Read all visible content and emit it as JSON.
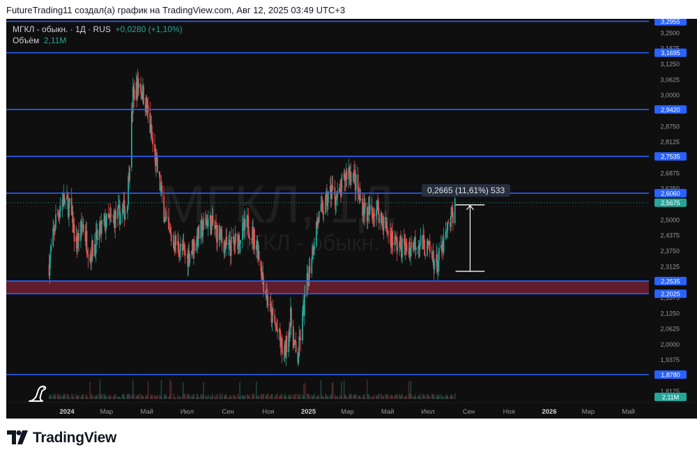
{
  "caption": "FutureTrading11 создал(а) график на TradingView.com, Авг 12, 2025 03:49 UTC+3",
  "header": {
    "symbol_line": "МГКЛ - обыкн. · 1Д · RUS",
    "change": "+0,0280 (+1,10%)",
    "volume_label": "Объём",
    "volume_value": "2,11M"
  },
  "measure_label": "0,2665 (11,61%) 533",
  "watermark": {
    "line1": "МГКЛ, 1Д",
    "line2": "МГКЛ - обыкн."
  },
  "brand": "TradingView",
  "colors": {
    "background": "#0f0f0f",
    "up": "#26a69a",
    "down": "#ef5350",
    "level_line": "#2962ff",
    "zone": "#6d1f33",
    "last_price": "#26a69a"
  },
  "chart_data": {
    "type": "candlestick",
    "symbol": "МГКЛ",
    "interval": "1Д",
    "y_axis_ticks": [
      "3,2500",
      "3,1875",
      "3,1250",
      "3,0625",
      "3,0000",
      "2,9375",
      "2,8750",
      "2,8125",
      "2,7500",
      "2,6875",
      "2,6250",
      "2,5625",
      "2,5000",
      "2,4375",
      "2,3750",
      "2,3125",
      "2,2500",
      "2,1875",
      "2,1250",
      "2,0625",
      "2,0000",
      "1,9375",
      "1,8750",
      "1,8125"
    ],
    "x_axis_ticks": [
      {
        "label": "2024",
        "bold": true,
        "date": "2024-01-01"
      },
      {
        "label": "Мар",
        "bold": false,
        "date": "2024-03-01"
      },
      {
        "label": "Май",
        "bold": false,
        "date": "2024-05-01"
      },
      {
        "label": "Июл",
        "bold": false,
        "date": "2024-07-01"
      },
      {
        "label": "Сен",
        "bold": false,
        "date": "2024-09-01"
      },
      {
        "label": "Ноя",
        "bold": false,
        "date": "2024-11-01"
      },
      {
        "label": "2025",
        "bold": true,
        "date": "2025-01-01"
      },
      {
        "label": "Мар",
        "bold": false,
        "date": "2025-03-01"
      },
      {
        "label": "Май",
        "bold": false,
        "date": "2025-05-01"
      },
      {
        "label": "Июл",
        "bold": false,
        "date": "2025-07-01"
      },
      {
        "label": "Сен",
        "bold": false,
        "date": "2025-09-01"
      },
      {
        "label": "Ноя",
        "bold": false,
        "date": "2025-11-01"
      },
      {
        "label": "2026",
        "bold": true,
        "date": "2026-01-01"
      },
      {
        "label": "Мар",
        "bold": false,
        "date": "2026-03-01"
      },
      {
        "label": "Май",
        "bold": false,
        "date": "2026-05-01"
      }
    ],
    "x_range": [
      "2023-10-01",
      "2026-06-01"
    ],
    "ylim": [
      1.78,
      3.3
    ],
    "horizontal_levels": [
      {
        "value": 3.2955,
        "label": "3,2955"
      },
      {
        "value": 3.1695,
        "label": "3,1695"
      },
      {
        "value": 2.942,
        "label": "2,9420"
      },
      {
        "value": 2.7535,
        "label": "2,7535"
      },
      {
        "value": 2.606,
        "label": "2,6060"
      },
      {
        "value": 2.2535,
        "label": "2,2535"
      },
      {
        "value": 2.2025,
        "label": "2,2025"
      },
      {
        "value": 1.878,
        "label": "1,8780"
      }
    ],
    "zone": {
      "from": 2.2025,
      "to": 2.2535
    },
    "last_price": {
      "value": 2.5675,
      "label": "2,5675"
    },
    "volume_last": "2,11M",
    "measure": {
      "from_date": "2025-08-12",
      "to_date": "2025-09-25",
      "low": 2.2925,
      "high": 2.559
    },
    "price_path": [
      {
        "date": "2023-12-05",
        "value": 2.32
      },
      {
        "date": "2023-12-15",
        "value": 2.5
      },
      {
        "date": "2023-12-25",
        "value": 2.58
      },
      {
        "date": "2024-01-05",
        "value": 2.55
      },
      {
        "date": "2024-01-15",
        "value": 2.4
      },
      {
        "date": "2024-01-25",
        "value": 2.48
      },
      {
        "date": "2024-02-05",
        "value": 2.36
      },
      {
        "date": "2024-02-15",
        "value": 2.42
      },
      {
        "date": "2024-02-25",
        "value": 2.48
      },
      {
        "date": "2024-03-10",
        "value": 2.5
      },
      {
        "date": "2024-03-20",
        "value": 2.52
      },
      {
        "date": "2024-04-01",
        "value": 2.55
      },
      {
        "date": "2024-04-10",
        "value": 3.0
      },
      {
        "date": "2024-04-20",
        "value": 3.05
      },
      {
        "date": "2024-05-01",
        "value": 2.95
      },
      {
        "date": "2024-05-10",
        "value": 2.8
      },
      {
        "date": "2024-05-20",
        "value": 2.65
      },
      {
        "date": "2024-06-01",
        "value": 2.45
      },
      {
        "date": "2024-06-15",
        "value": 2.4
      },
      {
        "date": "2024-07-01",
        "value": 2.35
      },
      {
        "date": "2024-07-15",
        "value": 2.42
      },
      {
        "date": "2024-08-01",
        "value": 2.5
      },
      {
        "date": "2024-08-15",
        "value": 2.45
      },
      {
        "date": "2024-09-01",
        "value": 2.38
      },
      {
        "date": "2024-09-15",
        "value": 2.42
      },
      {
        "date": "2024-10-01",
        "value": 2.48
      },
      {
        "date": "2024-10-15",
        "value": 2.4
      },
      {
        "date": "2024-10-25",
        "value": 2.25
      },
      {
        "date": "2024-11-05",
        "value": 2.12
      },
      {
        "date": "2024-11-15",
        "value": 2.05
      },
      {
        "date": "2024-11-25",
        "value": 1.95
      },
      {
        "date": "2024-12-05",
        "value": 2.1
      },
      {
        "date": "2024-12-15",
        "value": 1.92
      },
      {
        "date": "2024-12-25",
        "value": 2.15
      },
      {
        "date": "2025-01-05",
        "value": 2.35
      },
      {
        "date": "2025-01-15",
        "value": 2.5
      },
      {
        "date": "2025-01-25",
        "value": 2.55
      },
      {
        "date": "2025-02-05",
        "value": 2.62
      },
      {
        "date": "2025-02-15",
        "value": 2.58
      },
      {
        "date": "2025-03-01",
        "value": 2.7
      },
      {
        "date": "2025-03-10",
        "value": 2.68
      },
      {
        "date": "2025-03-20",
        "value": 2.58
      },
      {
        "date": "2025-04-01",
        "value": 2.52
      },
      {
        "date": "2025-04-15",
        "value": 2.55
      },
      {
        "date": "2025-05-01",
        "value": 2.45
      },
      {
        "date": "2025-05-15",
        "value": 2.4
      },
      {
        "date": "2025-06-01",
        "value": 2.38
      },
      {
        "date": "2025-06-15",
        "value": 2.42
      },
      {
        "date": "2025-07-01",
        "value": 2.38
      },
      {
        "date": "2025-07-15",
        "value": 2.32
      },
      {
        "date": "2025-07-25",
        "value": 2.4
      },
      {
        "date": "2025-08-05",
        "value": 2.5
      },
      {
        "date": "2025-08-12",
        "value": 2.5675
      }
    ]
  }
}
